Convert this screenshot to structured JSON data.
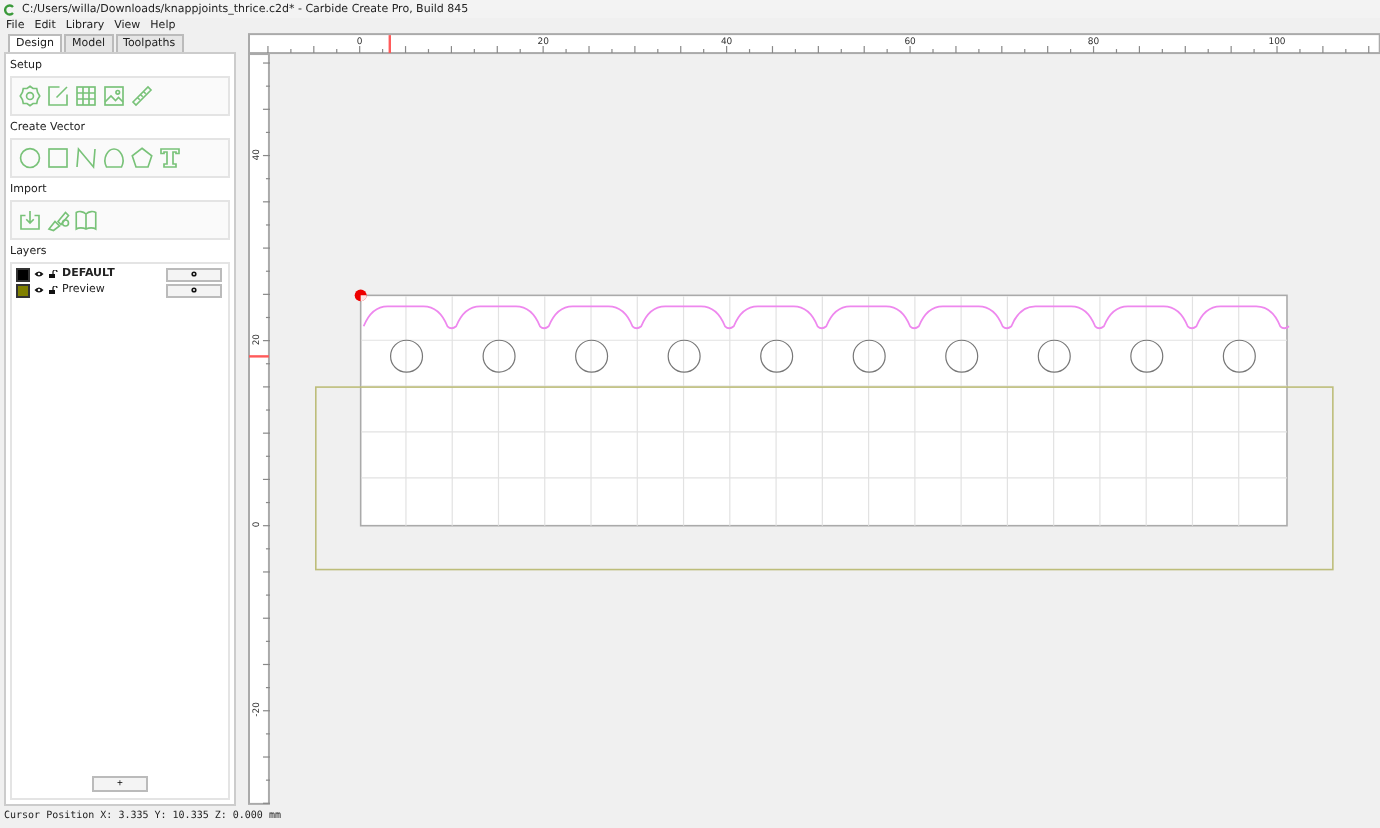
{
  "window": {
    "title": "C:/Users/willa/Downloads/knappjoints_thrice.c2d* - Carbide Create Pro, Build 845"
  },
  "menu": [
    "File",
    "Edit",
    "Library",
    "View",
    "Help"
  ],
  "tabs": [
    {
      "label": "Design",
      "selected": true
    },
    {
      "label": "Model",
      "selected": false
    },
    {
      "label": "Toolpaths",
      "selected": false
    }
  ],
  "sections": [
    "Setup",
    "Create Vector",
    "Import"
  ],
  "layers": {
    "title": "Layers",
    "items": [
      {
        "name": "DEFAULT",
        "color": "#000000",
        "selected": true
      },
      {
        "name": "Preview",
        "color": "#808000",
        "selected": false
      }
    ],
    "add_button": "+"
  },
  "rulers": {
    "horizontal": [
      "0",
      "20",
      "40",
      "60",
      "80",
      "100"
    ],
    "vertical": [
      "40",
      "20",
      "0",
      "-20"
    ]
  },
  "status_bar": "Cursor Position X: 3.335 Y: 10.335 Z: 0.000 mm"
}
